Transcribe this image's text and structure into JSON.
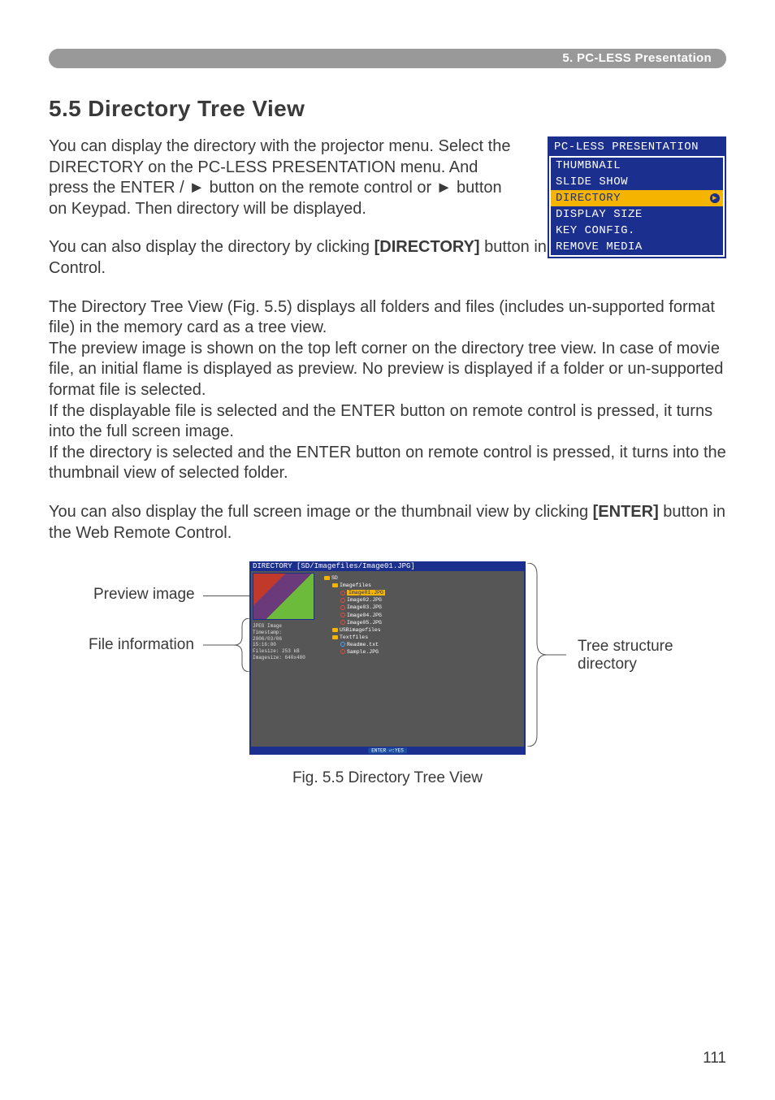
{
  "header": {
    "section_label": "5. PC-LESS Presentation"
  },
  "title": "5.5 Directory Tree View",
  "paras": {
    "intro": "You can display the directory with the projector menu. Select the DIRECTORY on the PC-LESS PRESENTATION menu. And press the ENTER / ► button on the remote control or ► button on Keypad. Then directory will be displayed.",
    "web_dir_pre": "You can also display the directory by clicking ",
    "web_dir_bold": "[DIRECTORY]",
    "web_dir_post": " button in the Web Remote Control.",
    "treeview": "The Directory Tree View (Fig. 5.5) displays all folders and files (includes un-supported format file) in the memory card as a tree view.\nThe preview image is shown on the top left corner on the directory tree view. In case of movie file, an initial flame is displayed as preview. No preview is displayed if a folder or un-supported format file is selected.\nIf the displayable file is selected and the ENTER button on remote control is pressed, it turns into the full screen image.\nIf the directory is selected and the ENTER button on remote control is pressed, it turns into the thumbnail view of selected folder.",
    "web_enter_pre": "You can also display the full screen image or the thumbnail view by clicking ",
    "web_enter_bold": "[ENTER]",
    "web_enter_post": " button in the Web Remote Control."
  },
  "menu": {
    "title": "PC-LESS PRESENTATION",
    "items": [
      "THUMBNAIL",
      "SLIDE SHOW",
      "DIRECTORY",
      "DISPLAY SIZE",
      "KEY CONFIG.",
      "REMOVE MEDIA"
    ],
    "selected_index": 2
  },
  "diagram": {
    "header_path": "DIRECTORY  [SD/Imagefiles/Image01.JPG]",
    "file_info_lines": [
      "JPEG Image",
      "Timestamp:",
      " 2006/03/06",
      " 15:16:00",
      "Filesize: 253 kB",
      "Imagesize: 640x480"
    ],
    "tree_lines": [
      {
        "indent": 0,
        "icon": "folder-minus",
        "text": "SD"
      },
      {
        "indent": 1,
        "icon": "folder-minus",
        "text": "Imagefiles"
      },
      {
        "indent": 2,
        "icon": "circle-red",
        "text": "Image01.JPG",
        "selected": true
      },
      {
        "indent": 2,
        "icon": "circle-red",
        "text": "Image02.JPG"
      },
      {
        "indent": 2,
        "icon": "circle-red",
        "text": "Image03.JPG"
      },
      {
        "indent": 2,
        "icon": "circle-red",
        "text": "Image04.JPG"
      },
      {
        "indent": 2,
        "icon": "circle-red",
        "text": "Image05.JPG"
      },
      {
        "indent": 1,
        "icon": "folder-plus",
        "text": "USBimagefiles"
      },
      {
        "indent": 1,
        "icon": "folder-minus",
        "text": "Textfiles"
      },
      {
        "indent": 2,
        "icon": "doc",
        "text": "Readme.txt"
      },
      {
        "indent": 2,
        "icon": "circle-red",
        "text": "Sample.JPG"
      }
    ],
    "footer_pill": "ENTER ⏎:YES",
    "annotations": {
      "preview": "Preview image",
      "file_info": "File information",
      "tree": "Tree structure directory"
    },
    "caption": "Fig. 5.5 Directory Tree View"
  },
  "page_number": "111"
}
